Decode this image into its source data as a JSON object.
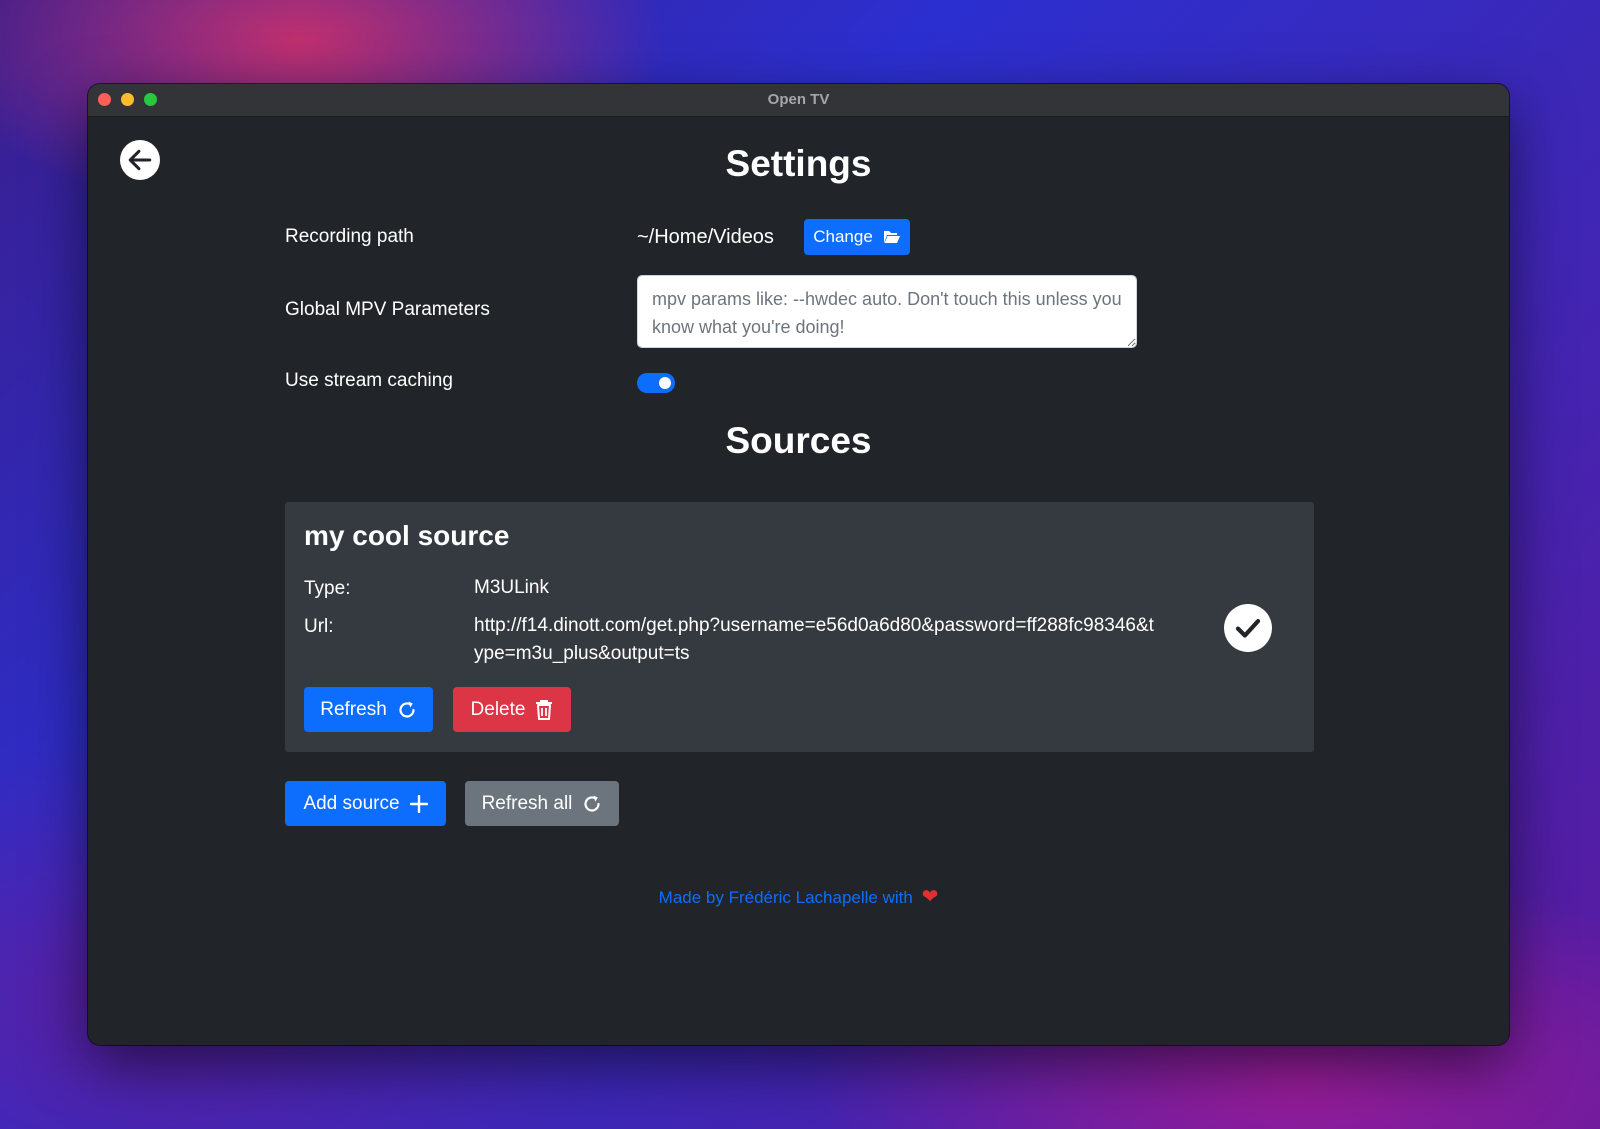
{
  "window": {
    "title": "Open TV"
  },
  "settings": {
    "heading": "Settings",
    "recording_path_label": "Recording path",
    "recording_path_value": "~/Home/Videos",
    "change_button_label": "Change",
    "mpv_label": "Global MPV Parameters",
    "mpv_placeholder": "mpv params like: --hwdec auto. Don't touch this unless you know what you're doing!",
    "mpv_value": "",
    "stream_caching_label": "Use stream caching",
    "stream_caching_enabled": true
  },
  "sources": {
    "heading": "Sources",
    "items": [
      {
        "name": "my cool source",
        "type_label": "Type:",
        "type_value": "M3ULink",
        "url_label": "Url:",
        "url_value": "http://f14.dinott.com/get.php?username=e56d0a6d80&password=ff288fc98346&type=m3u_plus&output=ts",
        "refresh_label": "Refresh",
        "delete_label": "Delete",
        "status": "check-icon"
      }
    ],
    "add_button_label": "Add source",
    "refresh_all_label": "Refresh all"
  },
  "footer": {
    "text": "Made by Frédéric Lachapelle with",
    "heart": "❤"
  },
  "icons": {
    "back": "arrow-left-icon",
    "change": "folder-open-icon",
    "refresh": "refresh-icon",
    "delete": "trash-icon",
    "add": "plus-icon",
    "status": "check-icon"
  },
  "colors": {
    "primary": "#0d6efd",
    "danger": "#dc3545",
    "secondary": "#6c757d",
    "card": "#353a40",
    "background": "#212529"
  }
}
